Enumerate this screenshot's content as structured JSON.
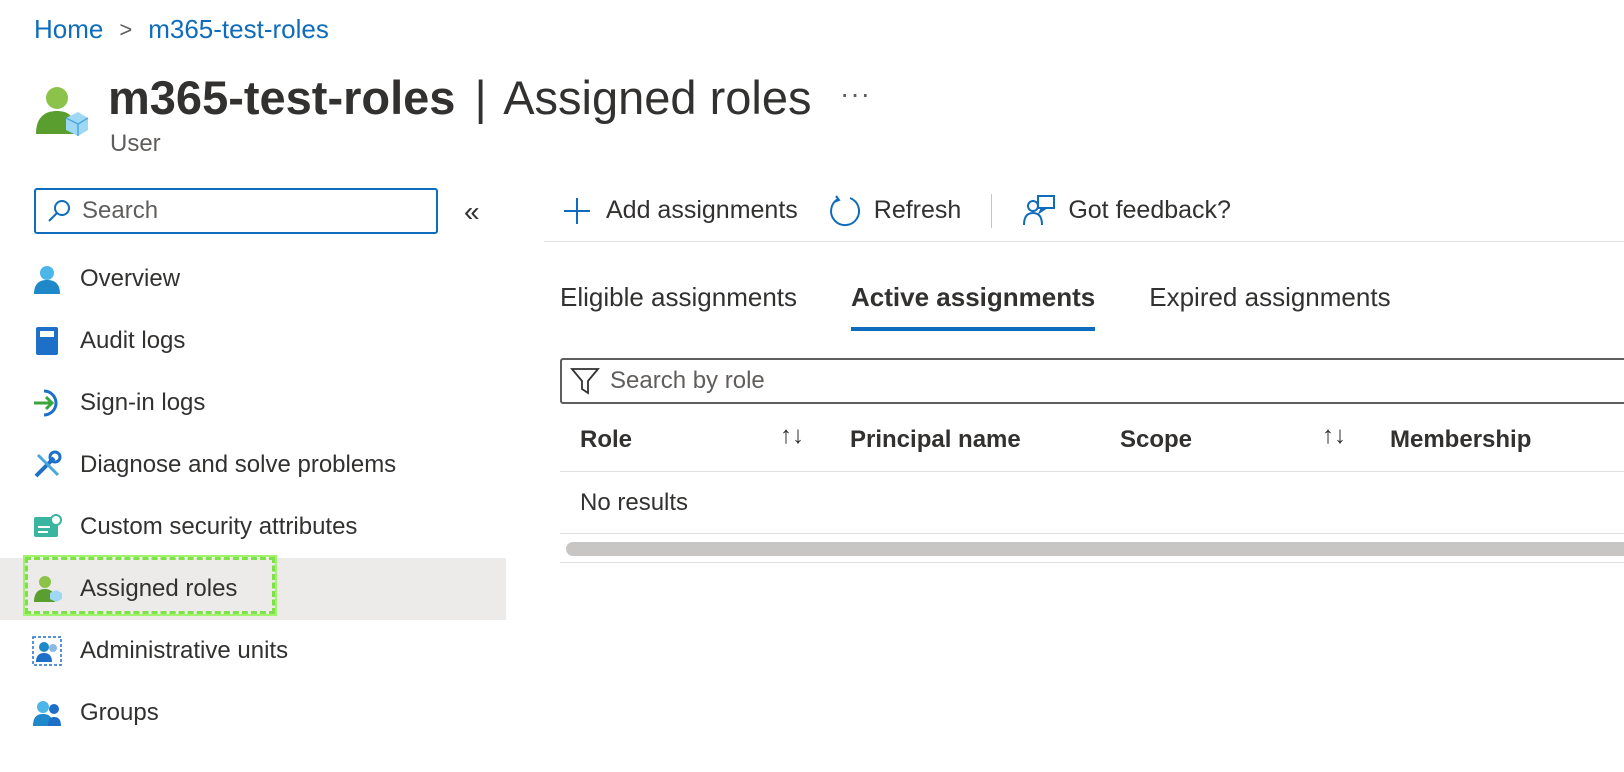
{
  "breadcrumb": {
    "home": "Home",
    "current": "m365-test-roles"
  },
  "header": {
    "title_name": "m365-test-roles",
    "title_separator": "|",
    "title_page": "Assigned roles",
    "more": "···",
    "subtitle": "User"
  },
  "sidebar": {
    "search_placeholder": "Search",
    "collapse": "«",
    "items": [
      {
        "label": "Overview",
        "icon": "user-icon"
      },
      {
        "label": "Audit logs",
        "icon": "book-icon"
      },
      {
        "label": "Sign-in logs",
        "icon": "sign-in-icon"
      },
      {
        "label": "Diagnose and solve problems",
        "icon": "wrench-icon"
      },
      {
        "label": "Custom security attributes",
        "icon": "attributes-icon"
      },
      {
        "label": "Assigned roles",
        "icon": "assigned-roles-icon",
        "active": true
      },
      {
        "label": "Administrative units",
        "icon": "admin-units-icon"
      },
      {
        "label": "Groups",
        "icon": "groups-icon"
      }
    ]
  },
  "toolbar": {
    "add": "Add assignments",
    "refresh": "Refresh",
    "feedback": "Got feedback?"
  },
  "tabs": [
    {
      "label": "Eligible assignments"
    },
    {
      "label": "Active assignments",
      "active": true
    },
    {
      "label": "Expired assignments"
    }
  ],
  "filter": {
    "placeholder": "Search by role"
  },
  "table": {
    "columns": [
      "Role",
      "Principal name",
      "Scope",
      "Membership"
    ],
    "sort_glyph": "↑↓",
    "empty": "No results"
  },
  "colors": {
    "accent": "#0f6cbd",
    "highlight": "#7fe04a",
    "active_bg": "#edebe9"
  }
}
